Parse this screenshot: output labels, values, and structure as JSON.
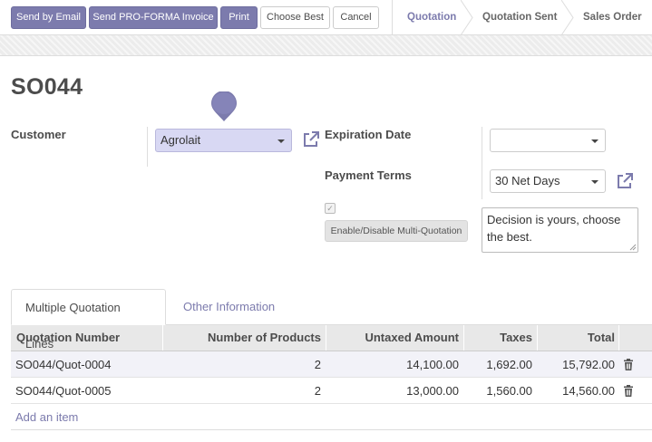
{
  "toolbar": {
    "send_email": "Send by Email",
    "send_proforma": "Send PRO-FORMA Invoice",
    "print": "Print",
    "choose_best": "Choose Best",
    "cancel": "Cancel"
  },
  "statusbar": {
    "stages": [
      "Quotation",
      "Quotation Sent",
      "Sales Order"
    ],
    "active": "Quotation"
  },
  "record": {
    "title": "SO044"
  },
  "form": {
    "customer_label": "Customer",
    "customer_value": "Agrolait",
    "expiration_label": "Expiration Date",
    "expiration_value": "",
    "payment_terms_label": "Payment Terms",
    "payment_terms_value": "30 Net Days",
    "multi_quotation_checked": true,
    "multi_quotation_button": "Enable/Disable Multi-Quotation",
    "note_text": "Decision is yours, choose the best."
  },
  "tabs": {
    "lines": "Multiple Quotation Lines",
    "other": "Other Information"
  },
  "table": {
    "headers": {
      "number": "Quotation Number",
      "products": "Number of Products",
      "untaxed": "Untaxed Amount",
      "taxes": "Taxes",
      "total": "Total"
    },
    "rows": [
      {
        "number": "SO044/Quot-0004",
        "products": "2",
        "untaxed": "14,100.00",
        "taxes": "1,692.00",
        "total": "15,792.00"
      },
      {
        "number": "SO044/Quot-0005",
        "products": "2",
        "untaxed": "13,000.00",
        "taxes": "1,560.00",
        "total": "14,560.00"
      }
    ],
    "add_item": "Add an item"
  },
  "colors": {
    "accent": "#7c7bad",
    "highlight": "#d8d8f3"
  }
}
